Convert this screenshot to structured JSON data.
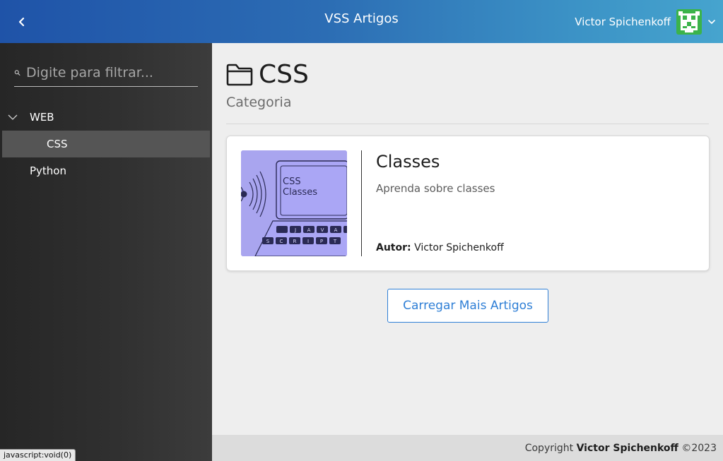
{
  "header": {
    "title": "VSS Artigos",
    "user_name": "Victor Spichenkoff"
  },
  "sidebar": {
    "search_placeholder": "Digite para filtrar...",
    "tree": [
      {
        "label": "WEB",
        "expanded": true,
        "children": [
          {
            "label": "CSS",
            "selected": true
          }
        ]
      },
      {
        "label": "Python"
      }
    ]
  },
  "main": {
    "title": "CSS",
    "subtitle": "Categoria",
    "articles": [
      {
        "title": "Classes",
        "description": "Aprenda sobre classes",
        "author_label": "Autor:",
        "author": "Victor Spichenkoff",
        "thumbnail": {
          "line1": "CSS",
          "line2": "Classes",
          "keys_row1": [
            "J",
            "A",
            "V",
            "A"
          ],
          "keys_row2": [
            "S",
            "C",
            "R",
            "I",
            "P",
            "T"
          ]
        }
      }
    ],
    "load_more_label": "Carregar Mais Artigos"
  },
  "footer": {
    "prefix": "Copyright",
    "name": "Victor Spichenkoff",
    "suffix": "©2023"
  },
  "status_bar": "javascript:void(0)",
  "colors": {
    "header_start": "#1f53a8",
    "header_end": "#46a4ce",
    "accent": "#2f7fd6",
    "sidebar_selected": "#555555",
    "avatar_green": "#3bb34a"
  }
}
